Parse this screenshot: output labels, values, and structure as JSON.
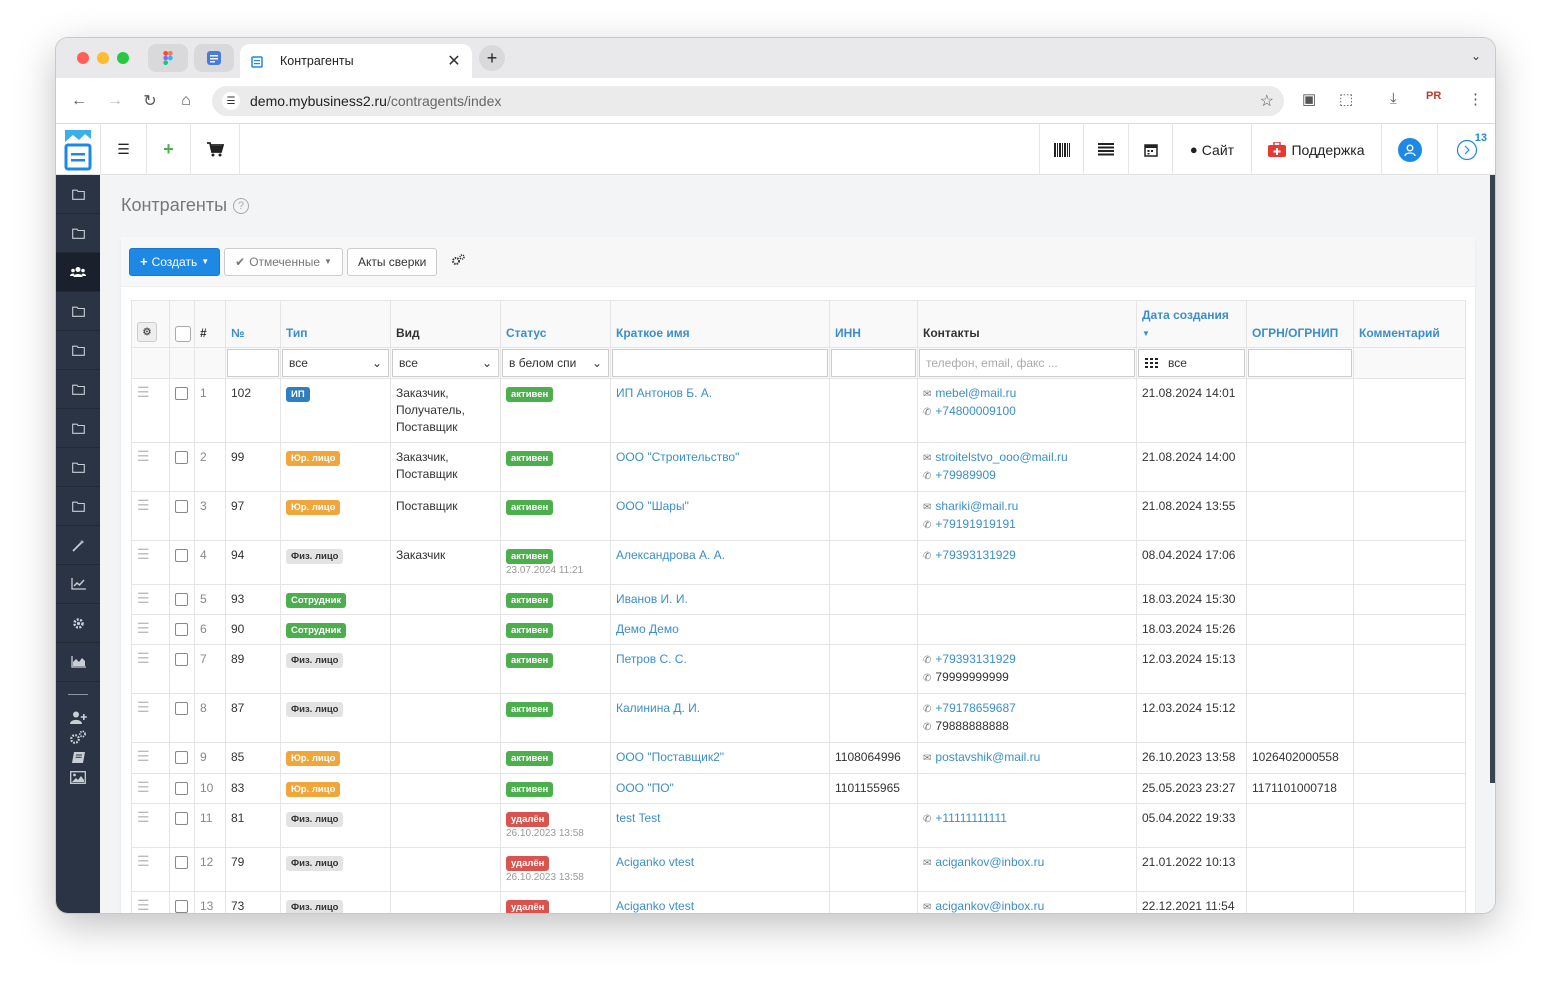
{
  "browser": {
    "tab_title": "Контрагенты",
    "url_host": "demo.mybusiness2.ru",
    "url_path": "/contragents/index",
    "ext_badge": "PR"
  },
  "topnav": {
    "site_label": "Сайт",
    "support_label": "Поддержка",
    "notif_count": "13"
  },
  "page": {
    "title": "Контрагенты",
    "help": "?"
  },
  "toolbar": {
    "create_label": "Создать",
    "marked_label": "Отмеченные",
    "acts_label": "Акты сверки"
  },
  "table": {
    "headers": {
      "hash": "#",
      "no": "№",
      "type": "Тип",
      "kind": "Вид",
      "status": "Статус",
      "name": "Краткое имя",
      "inn": "ИНН",
      "contacts": "Контакты",
      "created": "Дата создания",
      "ogrn": "ОГРН/ОГРНИП",
      "comment": "Комментарий"
    },
    "filters": {
      "type": "все",
      "kind": "все",
      "status": "в белом спи",
      "contacts_placeholder": "телефон, email, факс ...",
      "created": "все"
    },
    "rows": [
      {
        "idx": "1",
        "no": "102",
        "type": "ИП",
        "type_class": "b-ip",
        "kind": "Заказчик, Получатель, Поставщик",
        "status": "активен",
        "status_class": "b-act",
        "status_date": "",
        "name": "ИП Антонов Б. А.",
        "inn": "",
        "contacts": [
          {
            "kind": "mail",
            "text": "mebel@mail.ru",
            "link": true
          },
          {
            "kind": "phone",
            "text": "+74800009100",
            "link": true
          }
        ],
        "created": "21.08.2024 14:01",
        "ogrn": ""
      },
      {
        "idx": "2",
        "no": "99",
        "type": "Юр. лицо",
        "type_class": "b-ur",
        "kind": "Заказчик, Поставщик",
        "status": "активен",
        "status_class": "b-act",
        "status_date": "",
        "name": "ООО \"Строительство\"",
        "inn": "",
        "contacts": [
          {
            "kind": "mail",
            "text": "stroitelstvo_ooo@mail.ru",
            "link": true
          },
          {
            "kind": "phone",
            "text": "+79989909",
            "link": true
          }
        ],
        "created": "21.08.2024 14:00",
        "ogrn": ""
      },
      {
        "idx": "3",
        "no": "97",
        "type": "Юр. лицо",
        "type_class": "b-ur",
        "kind": "Поставщик",
        "status": "активен",
        "status_class": "b-act",
        "status_date": "",
        "name": "ООО \"Шары\"",
        "inn": "",
        "contacts": [
          {
            "kind": "mail",
            "text": "shariki@mail.ru",
            "link": true
          },
          {
            "kind": "phone",
            "text": "+79191919191",
            "link": true
          }
        ],
        "created": "21.08.2024 13:55",
        "ogrn": ""
      },
      {
        "idx": "4",
        "no": "94",
        "type": "Физ. лицо",
        "type_class": "b-fiz",
        "kind": "Заказчик",
        "status": "активен",
        "status_class": "b-act",
        "status_date": "23.07.2024 11:21",
        "name": "Александрова А. А.",
        "inn": "",
        "contacts": [
          {
            "kind": "phone",
            "text": "+79393131929",
            "link": true
          }
        ],
        "created": "08.04.2024 17:06",
        "ogrn": ""
      },
      {
        "idx": "5",
        "no": "93",
        "type": "Сотрудник",
        "type_class": "b-emp",
        "kind": "",
        "status": "активен",
        "status_class": "b-act",
        "status_date": "",
        "name": "Иванов И. И.",
        "inn": "",
        "contacts": [],
        "created": "18.03.2024 15:30",
        "ogrn": ""
      },
      {
        "idx": "6",
        "no": "90",
        "type": "Сотрудник",
        "type_class": "b-emp",
        "kind": "",
        "status": "активен",
        "status_class": "b-act",
        "status_date": "",
        "name": "Демо Демо",
        "inn": "",
        "contacts": [],
        "created": "18.03.2024 15:26",
        "ogrn": ""
      },
      {
        "idx": "7",
        "no": "89",
        "type": "Физ. лицо",
        "type_class": "b-fiz",
        "kind": "",
        "status": "активен",
        "status_class": "b-act",
        "status_date": "",
        "name": "Петров С. С.",
        "inn": "",
        "contacts": [
          {
            "kind": "phone",
            "text": "+79393131929",
            "link": true
          },
          {
            "kind": "phone",
            "text": "79999999999",
            "link": false
          }
        ],
        "created": "12.03.2024 15:13",
        "ogrn": ""
      },
      {
        "idx": "8",
        "no": "87",
        "type": "Физ. лицо",
        "type_class": "b-fiz",
        "kind": "",
        "status": "активен",
        "status_class": "b-act",
        "status_date": "",
        "name": "Калинина Д. И.",
        "inn": "",
        "contacts": [
          {
            "kind": "phone",
            "text": "+79178659687",
            "link": true
          },
          {
            "kind": "phone",
            "text": "79888888888",
            "link": false
          }
        ],
        "created": "12.03.2024 15:12",
        "ogrn": ""
      },
      {
        "idx": "9",
        "no": "85",
        "type": "Юр. лицо",
        "type_class": "b-ur",
        "kind": "",
        "status": "активен",
        "status_class": "b-act",
        "status_date": "",
        "name": "ООО \"Поставщик2\"",
        "inn": "1108064996",
        "contacts": [
          {
            "kind": "mail",
            "text": "postavshik@mail.ru",
            "link": true
          }
        ],
        "created": "26.10.2023 13:58",
        "ogrn": "1026402000558"
      },
      {
        "idx": "10",
        "no": "83",
        "type": "Юр. лицо",
        "type_class": "b-ur",
        "kind": "",
        "status": "активен",
        "status_class": "b-act",
        "status_date": "",
        "name": "ООО \"ПО\"",
        "inn": "1101155965",
        "contacts": [],
        "created": "25.05.2023 23:27",
        "ogrn": "1171101000718"
      },
      {
        "idx": "11",
        "no": "81",
        "type": "Физ. лицо",
        "type_class": "b-fiz",
        "kind": "",
        "status": "удалён",
        "status_class": "b-del",
        "status_date": "26.10.2023 13:58",
        "name": "test Test",
        "inn": "",
        "contacts": [
          {
            "kind": "phone",
            "text": "+11111111111",
            "link": true
          }
        ],
        "created": "05.04.2022 19:33",
        "ogrn": ""
      },
      {
        "idx": "12",
        "no": "79",
        "type": "Физ. лицо",
        "type_class": "b-fiz",
        "kind": "",
        "status": "удалён",
        "status_class": "b-del",
        "status_date": "26.10.2023 13:58",
        "name": "Aciganko vtest",
        "inn": "",
        "contacts": [
          {
            "kind": "mail",
            "text": "acigankov@inbox.ru",
            "link": true
          }
        ],
        "created": "21.01.2022 10:13",
        "ogrn": ""
      },
      {
        "idx": "13",
        "no": "73",
        "type": "Физ. лицо",
        "type_class": "b-fiz",
        "kind": "",
        "status": "удалён",
        "status_class": "b-del",
        "status_date": "",
        "name": "Aciganko vtest",
        "inn": "",
        "contacts": [
          {
            "kind": "mail",
            "text": "acigankov@inbox.ru",
            "link": true
          }
        ],
        "created": "22.12.2021 11:54",
        "ogrn": ""
      }
    ]
  }
}
